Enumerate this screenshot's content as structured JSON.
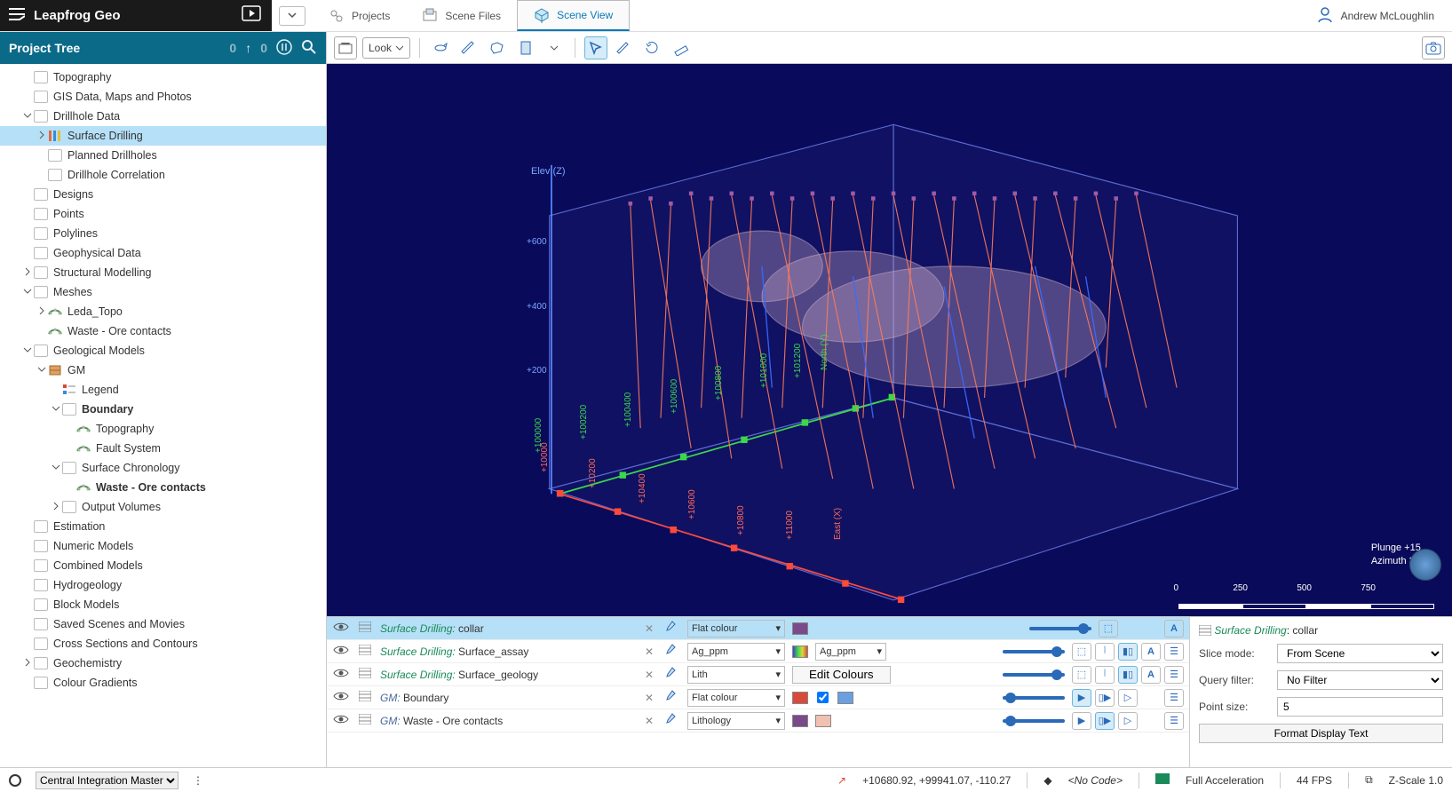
{
  "app": {
    "title": "Leapfrog Geo"
  },
  "user": {
    "name": "Andrew McLoughlin"
  },
  "top_tabs": [
    {
      "label": "Projects",
      "active": false
    },
    {
      "label": "Scene Files",
      "active": false
    },
    {
      "label": "Scene View",
      "active": true
    }
  ],
  "tree_header": {
    "title": "Project Tree",
    "count0": "0",
    "count1": "0"
  },
  "tree": [
    {
      "indent": 1,
      "caret": "",
      "icon": "folder",
      "label": "Topography"
    },
    {
      "indent": 1,
      "caret": "",
      "icon": "folder",
      "label": "GIS Data, Maps and Photos"
    },
    {
      "indent": 1,
      "caret": "v",
      "icon": "folder",
      "label": "Drillhole Data"
    },
    {
      "indent": 2,
      "caret": ">",
      "icon": "drill",
      "label": "Surface Drilling",
      "selected": true
    },
    {
      "indent": 2,
      "caret": "",
      "icon": "folder",
      "label": "Planned Drillholes"
    },
    {
      "indent": 2,
      "caret": "",
      "icon": "folder",
      "label": "Drillhole Correlation"
    },
    {
      "indent": 1,
      "caret": "",
      "icon": "folder",
      "label": "Designs"
    },
    {
      "indent": 1,
      "caret": "",
      "icon": "folder",
      "label": "Points"
    },
    {
      "indent": 1,
      "caret": "",
      "icon": "folder",
      "label": "Polylines"
    },
    {
      "indent": 1,
      "caret": "",
      "icon": "folder",
      "label": "Geophysical Data"
    },
    {
      "indent": 1,
      "caret": ">",
      "icon": "folder",
      "label": "Structural Modelling"
    },
    {
      "indent": 1,
      "caret": "v",
      "icon": "folder",
      "label": "Meshes"
    },
    {
      "indent": 2,
      "caret": ">",
      "icon": "mesh",
      "label": "Leda_Topo"
    },
    {
      "indent": 2,
      "caret": "",
      "icon": "mesh",
      "label": "Waste - Ore contacts"
    },
    {
      "indent": 1,
      "caret": "v",
      "icon": "folder",
      "label": "Geological Models"
    },
    {
      "indent": 2,
      "caret": "v",
      "icon": "gm",
      "label": "GM"
    },
    {
      "indent": 3,
      "caret": "",
      "icon": "legend",
      "label": "Legend"
    },
    {
      "indent": 3,
      "caret": "v",
      "icon": "folder",
      "label": "Boundary",
      "bold": true
    },
    {
      "indent": 4,
      "caret": "",
      "icon": "mesh",
      "label": "Topography"
    },
    {
      "indent": 4,
      "caret": "",
      "icon": "mesh",
      "label": "Fault System"
    },
    {
      "indent": 3,
      "caret": "v",
      "icon": "folder",
      "label": "Surface Chronology"
    },
    {
      "indent": 4,
      "caret": "",
      "icon": "mesh",
      "label": "Waste - Ore contacts",
      "bold": true
    },
    {
      "indent": 3,
      "caret": ">",
      "icon": "folder",
      "label": "Output Volumes"
    },
    {
      "indent": 1,
      "caret": "",
      "icon": "folder",
      "label": "Estimation"
    },
    {
      "indent": 1,
      "caret": "",
      "icon": "folder",
      "label": "Numeric Models"
    },
    {
      "indent": 1,
      "caret": "",
      "icon": "folder",
      "label": "Combined Models"
    },
    {
      "indent": 1,
      "caret": "",
      "icon": "folder",
      "label": "Hydrogeology"
    },
    {
      "indent": 1,
      "caret": "",
      "icon": "folder",
      "label": "Block Models"
    },
    {
      "indent": 1,
      "caret": "",
      "icon": "folder",
      "label": "Saved Scenes and Movies"
    },
    {
      "indent": 1,
      "caret": "",
      "icon": "folder",
      "label": "Cross Sections and Contours"
    },
    {
      "indent": 1,
      "caret": ">",
      "icon": "folder",
      "label": "Geochemistry"
    },
    {
      "indent": 1,
      "caret": "",
      "icon": "folder",
      "label": "Colour Gradients"
    }
  ],
  "toolbar": {
    "look": "Look"
  },
  "viewport": {
    "z_axis": "Elev (Z)",
    "z_ticks": [
      "+600",
      "+400",
      "+200"
    ],
    "east_axis": "East (X)",
    "north_axis": "North (Y)",
    "east_ticks": [
      "+10000",
      "+10200",
      "+10400",
      "+10600",
      "+10800",
      "+11000"
    ],
    "north_ticks": [
      "+100000",
      "+100200",
      "+100400",
      "+100600",
      "+100800",
      "+101000",
      "+101200"
    ],
    "plunge": "Plunge +15",
    "azimuth": "Azimuth 321",
    "scale": [
      "0",
      "250",
      "500",
      "750"
    ]
  },
  "layers": [
    {
      "sel": true,
      "group": "Surface Drilling",
      "name": "collar",
      "mode": "Flat colour",
      "swatch": "#7a4a8a",
      "slider": 95,
      "btnset": "points"
    },
    {
      "sel": false,
      "group": "Surface Drilling",
      "name": "Surface_assay",
      "mode": "Ag_ppm",
      "swatch": "rainbow",
      "extra": "Ag_ppm",
      "slider": 95,
      "btnset": "intervals"
    },
    {
      "sel": false,
      "group": "Surface Drilling",
      "name": "Surface_geology",
      "mode": "Lith",
      "swatch": "",
      "extra_btn": "Edit Colours",
      "slider": 95,
      "btnset": "intervals"
    },
    {
      "sel": false,
      "group": "GM",
      "groupstyle": "gm",
      "name": "Boundary",
      "mode": "Flat colour",
      "swatch": "#d84a3a",
      "swatch2": "#6aa0e0",
      "chk": true,
      "slider": 5,
      "btnset": "surface"
    },
    {
      "sel": false,
      "group": "GM",
      "groupstyle": "gm",
      "name": "Waste - Ore contacts",
      "mode": "Lithology",
      "swatch": "#7a4a8a",
      "swatch2": "#f0c0b0",
      "slider": 5,
      "btnset": "surface",
      "active_btn": 1
    }
  ],
  "props": {
    "title_group": "Surface Drilling",
    "title_name": "collar",
    "slice_mode_label": "Slice mode:",
    "slice_mode": "From Scene",
    "query_filter_label": "Query filter:",
    "query_filter": "No Filter",
    "point_size_label": "Point size:",
    "point_size": "5",
    "format_btn": "Format Display Text"
  },
  "status": {
    "central": "Central Integration Master",
    "coords": "+10680.92, +99941.07, -110.27",
    "code": "<No Code>",
    "accel": "Full Acceleration",
    "fps": "44 FPS",
    "zscale": "Z-Scale 1.0"
  }
}
